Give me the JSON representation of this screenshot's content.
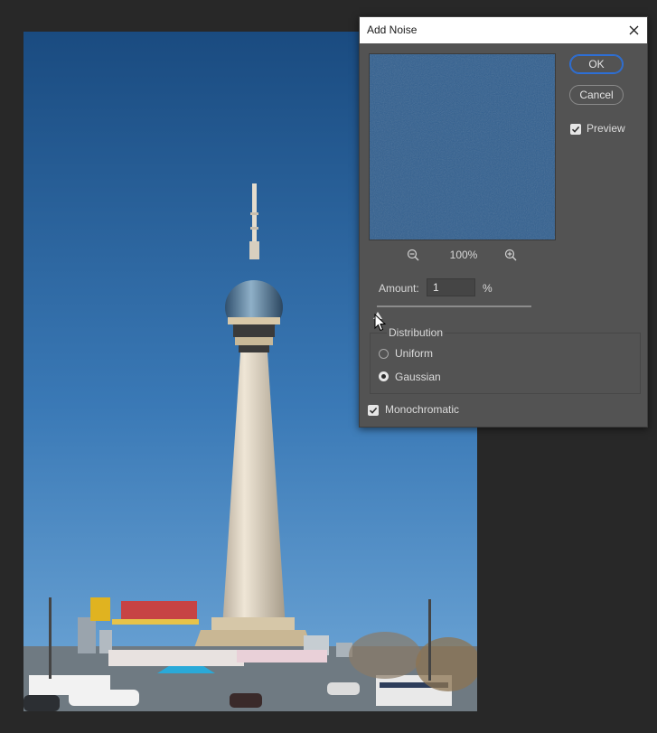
{
  "dialog": {
    "title": "Add Noise",
    "ok_label": "OK",
    "cancel_label": "Cancel",
    "preview_label": "Preview",
    "preview_checked": true,
    "zoom_level": "100%",
    "amount_label": "Amount:",
    "amount_value": "1",
    "amount_unit": "%",
    "amount_percent": 1,
    "distribution": {
      "legend": "Distribution",
      "options": [
        {
          "label": "Uniform",
          "selected": false
        },
        {
          "label": "Gaussian",
          "selected": true
        }
      ]
    },
    "monochromatic_label": "Monochromatic",
    "monochromatic_checked": true
  },
  "icons": {
    "close": "close-icon",
    "zoom_out": "zoom-out-icon",
    "zoom_in": "zoom-in-icon",
    "checkmark": "check-icon"
  },
  "colors": {
    "dialog_bg": "#535353",
    "app_bg": "#282828",
    "accent": "#2d6fd6",
    "preview_blue": "#315f8f"
  }
}
